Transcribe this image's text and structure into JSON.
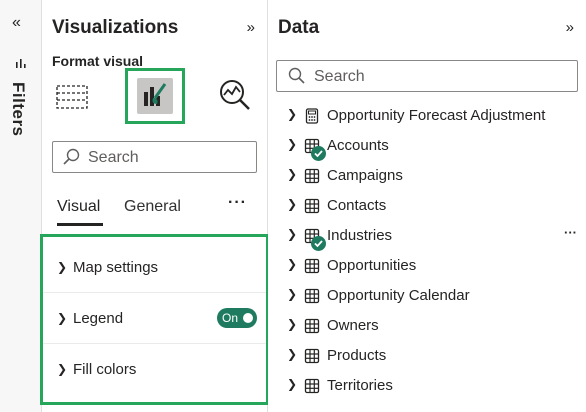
{
  "filters": {
    "label": "Filters",
    "collapse_icon": "«"
  },
  "visualizations": {
    "title": "Visualizations",
    "expand_icon": "»",
    "subtitle": "Format visual",
    "search_placeholder": "Search",
    "tabs": [
      {
        "label": "Visual"
      },
      {
        "label": "General"
      }
    ],
    "more_label": "···",
    "cards": [
      {
        "label": "Map settings"
      },
      {
        "label": "Legend",
        "toggle": "On"
      },
      {
        "label": "Fill colors"
      }
    ],
    "accent_color": "#26a65b"
  },
  "data": {
    "title": "Data",
    "expand_icon": "»",
    "search_placeholder": "Search",
    "tables": [
      {
        "label": "Opportunity Forecast Adjustment",
        "icon": "calculator-icon"
      },
      {
        "label": "Accounts",
        "icon": "table-icon",
        "check": true
      },
      {
        "label": "Campaigns",
        "icon": "table-icon"
      },
      {
        "label": "Contacts",
        "icon": "table-icon"
      },
      {
        "label": "Industries",
        "icon": "table-icon",
        "check": true,
        "more": "···"
      },
      {
        "label": "Opportunities",
        "icon": "table-icon"
      },
      {
        "label": "Opportunity Calendar",
        "icon": "table-icon"
      },
      {
        "label": "Owners",
        "icon": "table-icon"
      },
      {
        "label": "Products",
        "icon": "table-icon"
      },
      {
        "label": "Territories",
        "icon": "table-icon"
      }
    ],
    "check_color": "#1f7b5f"
  }
}
